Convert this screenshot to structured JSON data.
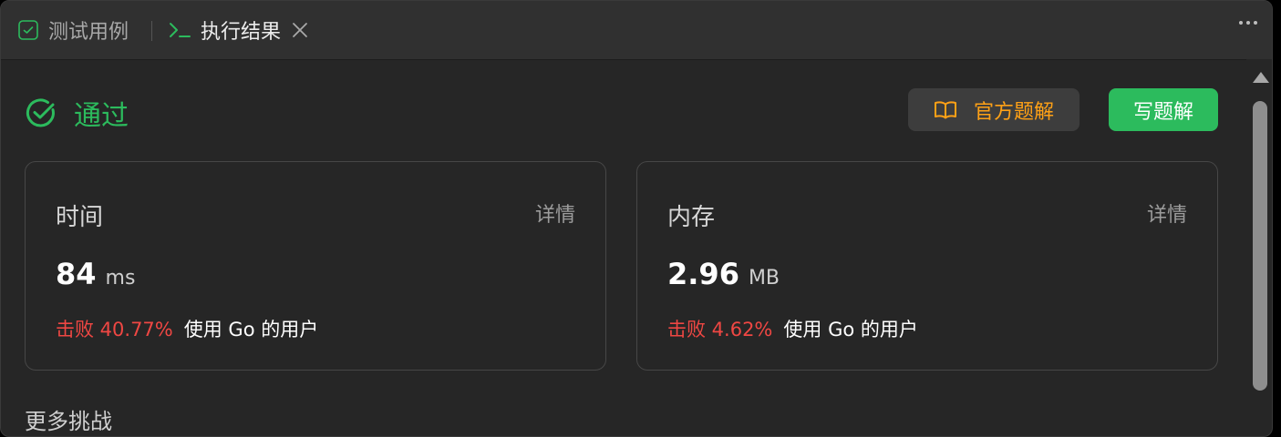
{
  "tabs": {
    "tests_label": "测试用例",
    "results_label": "执行结果"
  },
  "icons": {
    "tests": "checkbox-icon",
    "results": "terminal-icon",
    "close": "close-icon",
    "more": "more-dots-icon",
    "status": "check-circle-icon",
    "official": "book-icon"
  },
  "status": {
    "text": "通过"
  },
  "buttons": {
    "official_solution": "官方题解",
    "write_solution": "写题解"
  },
  "time_card": {
    "title": "时间",
    "detail": "详情",
    "value": "84",
    "unit": "ms",
    "beat": "击败 40.77%",
    "beat_suffix": "使用 Go 的用户"
  },
  "memory_card": {
    "title": "内存",
    "detail": "详情",
    "value": "2.96",
    "unit": "MB",
    "beat": "击败 4.62%",
    "beat_suffix": "使用 Go 的用户"
  },
  "more_section": {
    "title": "更多挑战"
  },
  "colors": {
    "accent_green": "#2cbb5d",
    "accent_orange": "#ffa116",
    "beat_red": "#ef4743",
    "background": "#262626"
  }
}
